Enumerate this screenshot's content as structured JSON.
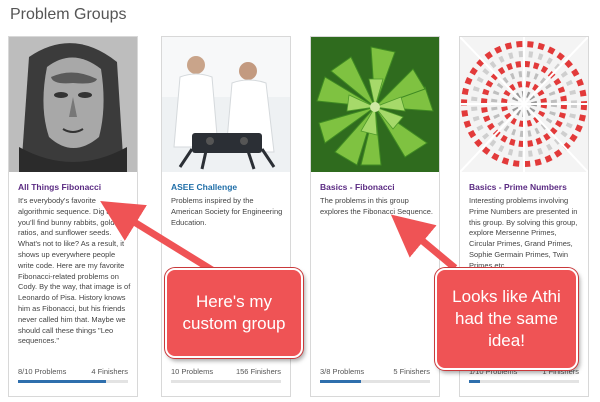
{
  "page": {
    "title": "Problem Groups"
  },
  "cards": [
    {
      "title": "All Things Fibonacci",
      "title_color": "#5a2a82",
      "description": "It's everybody's favorite algorithmic sequence. Dig and you'll find bunny rabbits, golden ratios, and sunflower seeds. What's not to like? As a result, it shows up everywhere people write code. Here are my favorite Fibonacci-related problems on Cody. By the way, that image is of Leonardo of Pisa. History knows him as Fibonacci, but his friends never called him that. Maybe we should call these things \"Leo sequences.\"",
      "problems": "8/10 Problems",
      "finishers": "4 Finishers",
      "progress": 0.8
    },
    {
      "title": "ASEE Challenge",
      "title_color": "#1f6ea8",
      "description": "Problems inspired by the American Society for Engineering Education.",
      "problems": "10 Problems",
      "finishers": "156 Finishers",
      "progress": 0.0
    },
    {
      "title": "Basics - Fibonacci",
      "title_color": "#5a2a82",
      "description": "The problems in this group explores the Fibonacci Sequence.",
      "problems": "3/8 Problems",
      "finishers": "5 Finishers",
      "progress": 0.375
    },
    {
      "title": "Basics - Prime Numbers",
      "title_color": "#5a2a82",
      "description": "Interesting problems involving Prime Numbers are presented in this group. By solving this group, explore Mersenne Primes, Circular Primes, Grand Primes, Sophie Germain Primes, Twin Primes etc.",
      "problems": "1/10 Problems",
      "finishers": "1 Finishers",
      "progress": 0.1
    }
  ],
  "callouts": [
    {
      "text": "Here's my\ncustom group"
    },
    {
      "text": "Looks like Athi\nhad the same\nidea!"
    }
  ],
  "colors": {
    "callout": "#ef5355",
    "progress": "#2f6fad"
  }
}
